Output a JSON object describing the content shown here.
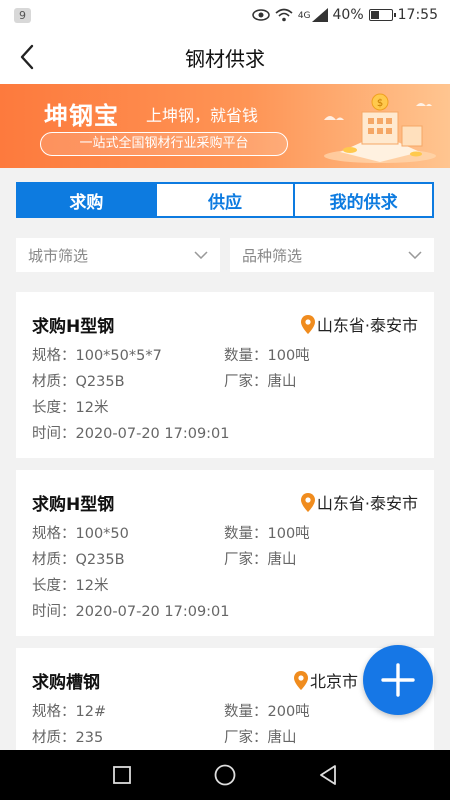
{
  "status_bar": {
    "notification_count": "9",
    "network": "4G",
    "battery_level": 0.4,
    "battery": "40%",
    "time": "17:55"
  },
  "nav": {
    "title": "钢材供求"
  },
  "banner": {
    "brand": "坤钢宝",
    "slogan": "上坤钢，就省钱",
    "tagline": "一站式全国钢材行业采购平台"
  },
  "tabs": [
    {
      "label": "求购",
      "active": true
    },
    {
      "label": "供应",
      "active": false
    },
    {
      "label": "我的供求",
      "active": false
    }
  ],
  "filters": {
    "city": "城市筛选",
    "type": "品种筛选"
  },
  "listings": [
    {
      "title": "求购H型钢",
      "location": "山东省·泰安市",
      "spec_label": "规格：",
      "spec": "100*50*5*7",
      "qty_label": "数量：",
      "qty": "100吨",
      "material_label": "材质：",
      "material": "Q235B",
      "maker_label": "厂家：",
      "maker": "唐山",
      "length_label": "长度：",
      "length": "12米",
      "time_label": "时间：",
      "time": "2020-07-20 17:09:01"
    },
    {
      "title": "求购H型钢",
      "location": "山东省·泰安市",
      "spec_label": "规格：",
      "spec": "100*50",
      "qty_label": "数量：",
      "qty": "100吨",
      "material_label": "材质：",
      "material": "Q235B",
      "maker_label": "厂家：",
      "maker": "唐山",
      "length_label": "长度：",
      "length": "12米",
      "time_label": "时间：",
      "time": "2020-07-20 17:09:01"
    },
    {
      "title": "求购槽钢",
      "location": "北京市",
      "spec_label": "规格：",
      "spec": "12#",
      "qty_label": "数量：",
      "qty": "200吨",
      "material_label": "材质：",
      "material": "235",
      "maker_label": "厂家：",
      "maker": "唐山"
    }
  ],
  "colors": {
    "primary": "#0d7be0",
    "fab": "#1677e6",
    "banner_start": "#fd7a3d",
    "location_pin": "#f08c1e"
  },
  "icons": {
    "back": "chevron-left-icon",
    "location": "location-pin-icon",
    "fab": "plus-icon"
  }
}
